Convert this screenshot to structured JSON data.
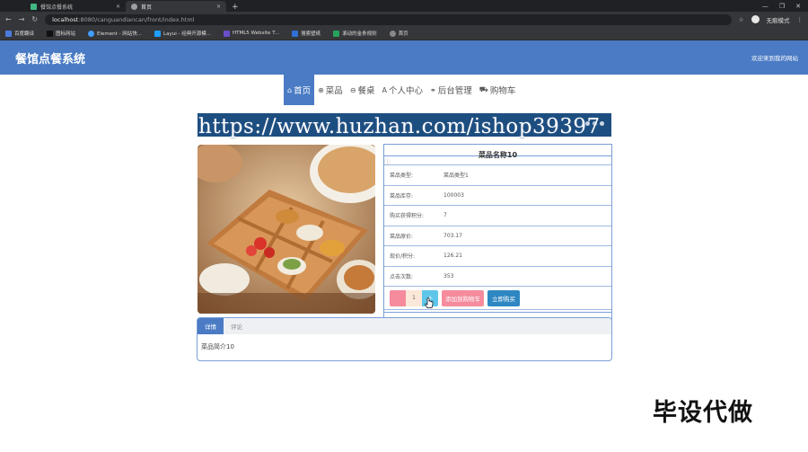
{
  "browser": {
    "tabs": [
      {
        "title": "",
        "favicon": "circle"
      },
      {
        "title": "",
        "favicon": "green-square"
      },
      {
        "title": "餐馆点餐系统",
        "favicon": "vue"
      },
      {
        "title": "首页",
        "favicon": "globe"
      }
    ],
    "new_tab": "+",
    "url_host": "localhost",
    "url_rest": ":8080/canguandiancan/front/index.html",
    "profile_label": "无痕模式",
    "bookmarks": [
      {
        "label": "百度翻译",
        "color": "#4a7bdc"
      },
      {
        "label": "图标网站",
        "color": "#222222"
      },
      {
        "label": "Element - 网站快...",
        "color": "#409eff"
      },
      {
        "label": "Layui - 经典开源模...",
        "color": "#1e9fff"
      },
      {
        "label": "HTML5 Website T...",
        "color": "#6a4fc8"
      },
      {
        "label": "搜索壁纸",
        "color": "#2f6fd6"
      },
      {
        "label": "滚动的金条规则",
        "color": "#25a35a"
      },
      {
        "label": "首页",
        "color": "#888888"
      }
    ]
  },
  "header": {
    "title": "餐馆点餐系统",
    "welcome": "欢迎来到我的网站"
  },
  "nav": [
    {
      "label": "首页",
      "icon": "home-icon",
      "glyph": "⌂",
      "active": true
    },
    {
      "label": "菜品",
      "icon": "dish-icon",
      "glyph": "⊕",
      "active": false
    },
    {
      "label": "餐桌",
      "icon": "table-icon",
      "glyph": "⊖",
      "active": false
    },
    {
      "label": "个人中心",
      "icon": "user-icon",
      "glyph": "A",
      "active": false
    },
    {
      "label": "后台管理",
      "icon": "link-icon",
      "glyph": "⚭",
      "active": false
    },
    {
      "label": "购物车",
      "icon": "cart-icon",
      "glyph": "⛟",
      "active": false
    }
  ],
  "product": {
    "name": "菜品名称10",
    "rows": [
      {
        "key": "菜品类型:",
        "value": "菜品类型1"
      },
      {
        "key": "菜品库存:",
        "value": "100003"
      },
      {
        "key": "购买获得积分:",
        "value": "7"
      },
      {
        "key": "菜品原价:",
        "value": "703.17"
      },
      {
        "key": "现价/积分:",
        "value": "126.21"
      },
      {
        "key": "点击次数:",
        "value": "353"
      }
    ],
    "quantity": "1",
    "plus": "+",
    "add_to_cart": "添加到购物车",
    "buy_now": "立即购买"
  },
  "detail": {
    "tabs": [
      "详情",
      "评论"
    ],
    "active_tab": 0,
    "content": "菜品简介10"
  },
  "watermark": {
    "url": "https://www.huzhan.com/ishop39397",
    "corner": "毕设代做"
  },
  "colors": {
    "header_blue": "#4a7bc4",
    "cart_pink": "#f58b9c",
    "buy_blue": "#2f87c2",
    "plus_cyan": "#5fc6ea"
  }
}
